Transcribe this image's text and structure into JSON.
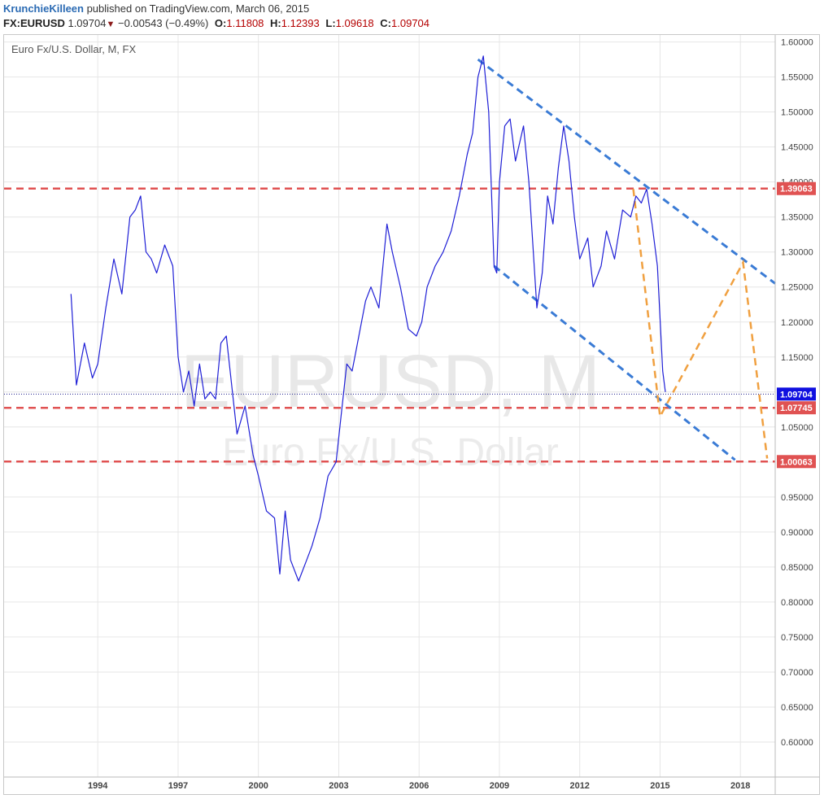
{
  "header": {
    "author": "KrunchieKilleen",
    "published_text": " published on TradingView.com, March 06, 2015",
    "symbol": "FX:EURUSD",
    "last": "1.09704",
    "change": "−0.00543 (−0.49%)",
    "open_label": "O:",
    "open": "1.11808",
    "high_label": "H:",
    "high": "1.12393",
    "low_label": "L:",
    "low": "1.09618",
    "close_label": "C:",
    "close": "1.09704"
  },
  "series_title": "Euro Fx/U.S. Dollar, M, FX",
  "watermark": {
    "symbol": "EURUSD, M",
    "name": "Euro Fx/U.S. Dollar"
  },
  "colors": {
    "price_line": "#1f1fd6",
    "red_level": "#e05252",
    "blue_trend": "#3a7bd5",
    "orange_projection": "#f0a040",
    "grid": "#e6e6e6"
  },
  "chart_data": {
    "type": "line",
    "title": "Euro Fx/U.S. Dollar, M, FX",
    "x_range": [
      1990.5,
      2019.3
    ],
    "ylim": [
      0.55,
      1.61
    ],
    "grid": true,
    "x_ticks": [
      "1994",
      "1997",
      "2000",
      "2003",
      "2006",
      "2009",
      "2012",
      "2015",
      "2018"
    ],
    "y_ticks": [
      "1.60000",
      "1.55000",
      "1.50000",
      "1.45000",
      "1.40000",
      "1.35000",
      "1.30000",
      "1.25000",
      "1.20000",
      "1.15000",
      "1.10000",
      "1.05000",
      "1.00000",
      "0.95000",
      "0.90000",
      "0.85000",
      "0.80000",
      "0.75000",
      "0.70000",
      "0.65000",
      "0.60000"
    ],
    "series": [
      {
        "x": [
          1993.0,
          1993.2,
          1993.5,
          1993.8,
          1994.0,
          1994.3,
          1994.6,
          1994.9,
          1995.2,
          1995.4,
          1995.6,
          1995.8,
          1996.0,
          1996.2,
          1996.5,
          1996.8,
          1997.0,
          1997.2,
          1997.4,
          1997.6,
          1997.8,
          1998.0,
          1998.2,
          1998.4,
          1998.6,
          1998.8,
          1999.0,
          1999.2,
          1999.5,
          1999.8,
          2000.0,
          2000.3,
          2000.6,
          2000.8,
          2001.0,
          2001.2,
          2001.5,
          2001.8,
          2002.0,
          2002.3,
          2002.6,
          2002.9,
          2003.1,
          2003.3,
          2003.5,
          2003.7,
          2004.0,
          2004.2,
          2004.5,
          2004.8,
          2005.0,
          2005.3,
          2005.6,
          2005.9,
          2006.1,
          2006.3,
          2006.6,
          2006.9,
          2007.2,
          2007.5,
          2007.8,
          2008.0,
          2008.2,
          2008.4,
          2008.6,
          2008.8,
          2008.9,
          2009.0,
          2009.2,
          2009.4,
          2009.6,
          2009.9,
          2010.1,
          2010.4,
          2010.6,
          2010.8,
          2011.0,
          2011.2,
          2011.4,
          2011.6,
          2011.8,
          2012.0,
          2012.3,
          2012.5,
          2012.8,
          2013.0,
          2013.3,
          2013.6,
          2013.9,
          2014.1,
          2014.3,
          2014.5,
          2014.7,
          2014.9,
          2015.1,
          2015.2
        ],
        "y": [
          1.24,
          1.11,
          1.17,
          1.12,
          1.14,
          1.22,
          1.29,
          1.24,
          1.35,
          1.36,
          1.38,
          1.3,
          1.29,
          1.27,
          1.31,
          1.28,
          1.15,
          1.1,
          1.13,
          1.08,
          1.14,
          1.09,
          1.1,
          1.09,
          1.17,
          1.18,
          1.11,
          1.04,
          1.08,
          1.01,
          0.98,
          0.93,
          0.92,
          0.84,
          0.93,
          0.86,
          0.83,
          0.86,
          0.88,
          0.92,
          0.98,
          1.0,
          1.07,
          1.14,
          1.13,
          1.17,
          1.23,
          1.25,
          1.22,
          1.34,
          1.3,
          1.25,
          1.19,
          1.18,
          1.2,
          1.25,
          1.28,
          1.3,
          1.33,
          1.38,
          1.44,
          1.47,
          1.55,
          1.58,
          1.5,
          1.28,
          1.27,
          1.4,
          1.48,
          1.49,
          1.43,
          1.48,
          1.4,
          1.22,
          1.27,
          1.38,
          1.34,
          1.42,
          1.48,
          1.43,
          1.35,
          1.29,
          1.32,
          1.25,
          1.28,
          1.33,
          1.29,
          1.36,
          1.35,
          1.38,
          1.37,
          1.39,
          1.34,
          1.28,
          1.13,
          1.1
        ]
      }
    ],
    "hlines": [
      {
        "value": 1.39063,
        "label": "1.39063"
      },
      {
        "value": 1.07745,
        "label": "1.07745"
      },
      {
        "value": 1.00063,
        "label": "1.00063"
      }
    ],
    "last_price": {
      "value": 1.09704,
      "label": "1.09704"
    },
    "trendlines": [
      {
        "x": [
          2008.2,
          2019.3
        ],
        "y": [
          1.575,
          1.255
        ]
      },
      {
        "x": [
          2008.8,
          2017.8
        ],
        "y": [
          1.28,
          1.003
        ]
      }
    ],
    "projection": {
      "x": [
        2014.0,
        2015.0,
        2018.1,
        2019.0
      ],
      "y": [
        1.39,
        1.065,
        1.285,
        1.005
      ]
    }
  }
}
